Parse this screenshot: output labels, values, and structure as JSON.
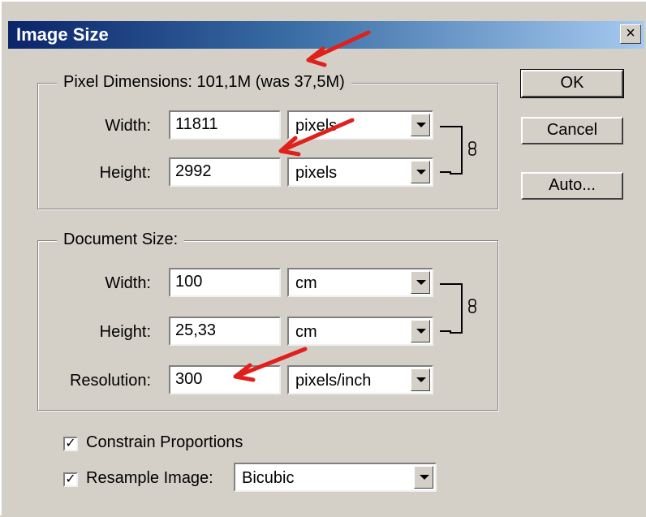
{
  "window": {
    "title": "Image Size",
    "close_glyph": "×"
  },
  "pixel_dimensions": {
    "legend": "Pixel Dimensions:  101,1M (was 37,5M)",
    "width_label": "Width:",
    "width_value": "11811",
    "width_unit": "pixels",
    "height_label": "Height:",
    "height_value": "2992",
    "height_unit": "pixels"
  },
  "document_size": {
    "legend": "Document Size:",
    "width_label": "Width:",
    "width_value": "100",
    "width_unit": "cm",
    "height_label": "Height:",
    "height_value": "25,33",
    "height_unit": "cm",
    "resolution_label": "Resolution:",
    "resolution_value": "300",
    "resolution_unit": "pixels/inch"
  },
  "options": {
    "constrain_label": "Constrain Proportions",
    "constrain_checked": true,
    "resample_label": "Resample Image:",
    "resample_checked": true,
    "resample_method": "Bicubic",
    "check_glyph": "✓"
  },
  "buttons": {
    "ok": "OK",
    "cancel": "Cancel",
    "auto": "Auto..."
  },
  "annotations": {
    "arrow_color": "#e0201c"
  },
  "icons": {
    "link": "chain-link-icon"
  }
}
